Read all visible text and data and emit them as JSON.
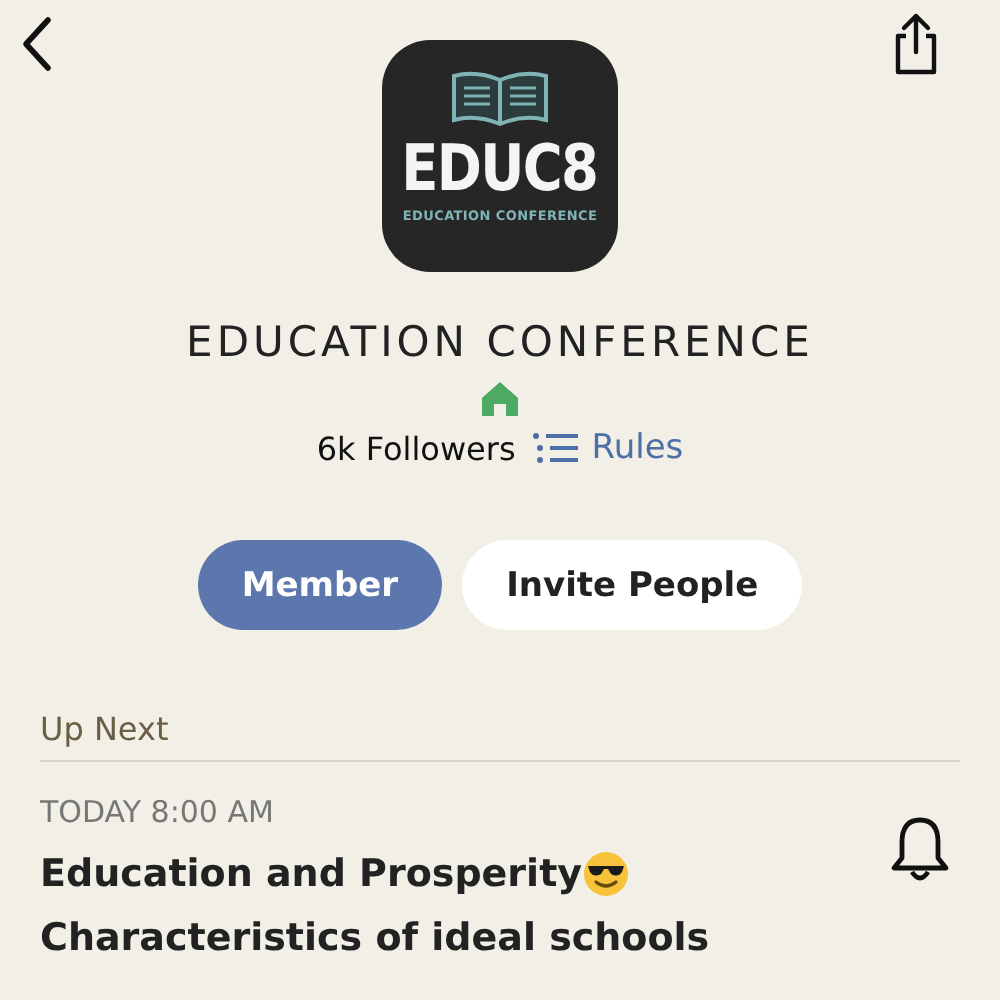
{
  "logo": {
    "wordmark": "EDUC8",
    "tagline": "EDUCATION CONFERENCE"
  },
  "club": {
    "name": "EDUCATION CONFERENCE",
    "followers": "6k Followers",
    "rules_link": "Rules"
  },
  "buttons": [
    {
      "label": "Member",
      "kind": "filled"
    },
    {
      "label": "Invite People",
      "kind": "outline"
    }
  ],
  "section": {
    "title": "Up Next"
  },
  "event": {
    "time": "TODAY 8:00 AM",
    "title_lines": [
      {
        "text": "Education and Prosperity",
        "emoji": true
      },
      {
        "text": "Characteristics of ideal schools",
        "emoji": false
      }
    ],
    "notify": false
  }
}
